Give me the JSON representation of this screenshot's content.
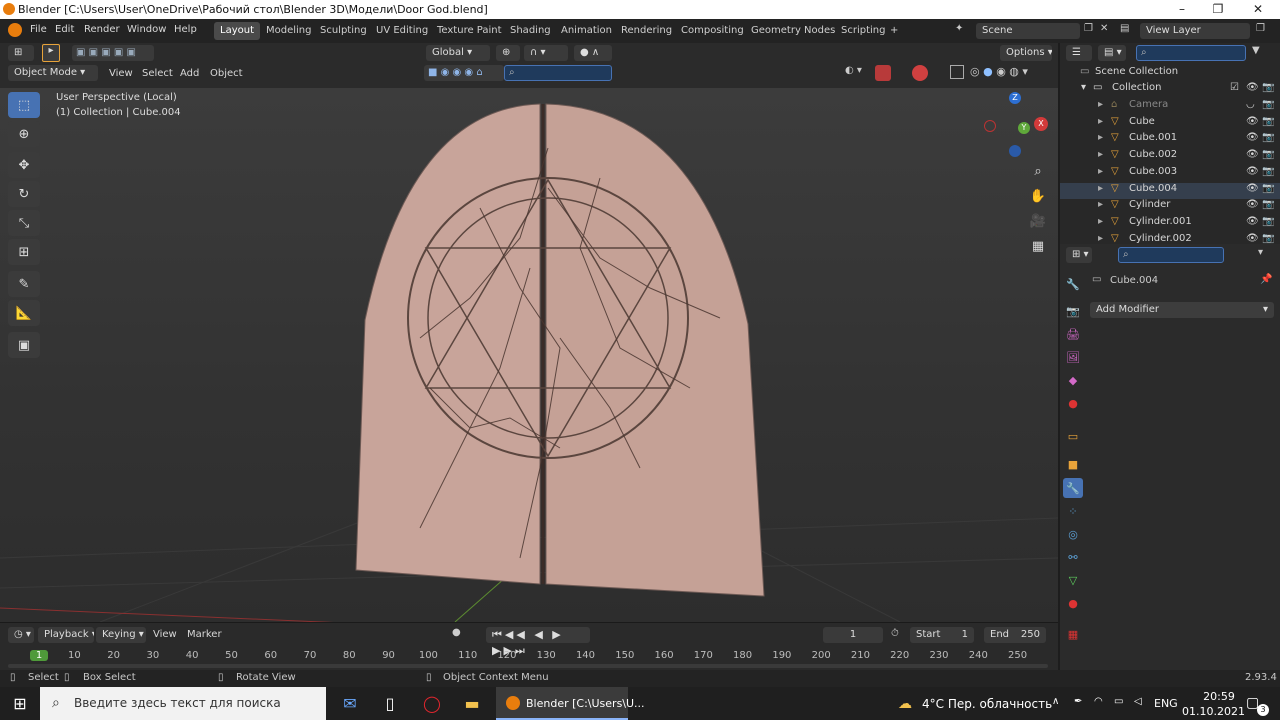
{
  "titlebar": {
    "title": "Blender [C:\\Users\\User\\OneDrive\\Рабочий стол\\Blender 3D\\Модели\\Door God.blend]"
  },
  "menu": [
    "File",
    "Edit",
    "Render",
    "Window",
    "Help"
  ],
  "workspaces": [
    "Layout",
    "Modeling",
    "Sculpting",
    "UV Editing",
    "Texture Paint",
    "Shading",
    "Animation",
    "Rendering",
    "Compositing",
    "Geometry Nodes",
    "Scripting"
  ],
  "scene": {
    "scene_label": "Scene",
    "view_layer_label": "View Layer"
  },
  "viewport_header": {
    "transform_orientation": "Global",
    "options_label": "Options",
    "mode": "Object Mode",
    "menus": [
      "View",
      "Select",
      "Add",
      "Object"
    ]
  },
  "viewport": {
    "perspective": "User Perspective (Local)",
    "collection_info": "(1) Collection | Cube.004"
  },
  "outliner": {
    "root": "Scene Collection",
    "collection": "Collection",
    "items": [
      "Camera",
      "Cube",
      "Cube.001",
      "Cube.002",
      "Cube.003",
      "Cube.004",
      "Cylinder",
      "Cylinder.001",
      "Cylinder.002"
    ],
    "selected": "Cube.004"
  },
  "properties": {
    "object_name": "Cube.004",
    "add_modifier": "Add Modifier"
  },
  "timeline": {
    "menus": [
      "Playback",
      "Keying",
      "View",
      "Marker"
    ],
    "current_frame": "1",
    "start_label": "Start",
    "start_value": "1",
    "end_label": "End",
    "end_value": "250",
    "ticks": [
      "1",
      "10",
      "20",
      "30",
      "40",
      "50",
      "60",
      "70",
      "80",
      "90",
      "100",
      "110",
      "120",
      "130",
      "140",
      "150",
      "160",
      "170",
      "180",
      "190",
      "200",
      "210",
      "220",
      "230",
      "240",
      "250"
    ]
  },
  "statusbar": {
    "select": "Select",
    "box_select": "Box Select",
    "rotate_view": "Rotate View",
    "context_menu": "Object Context Menu",
    "version": "2.93.4"
  },
  "taskbar": {
    "search_placeholder": "Введите здесь текст для поиска",
    "app_label": "Blender [C:\\Users\\U...",
    "weather": "4°C  Пер. облачность",
    "lang": "ENG",
    "time": "20:59",
    "date": "01.10.2021",
    "notifications": "3"
  }
}
